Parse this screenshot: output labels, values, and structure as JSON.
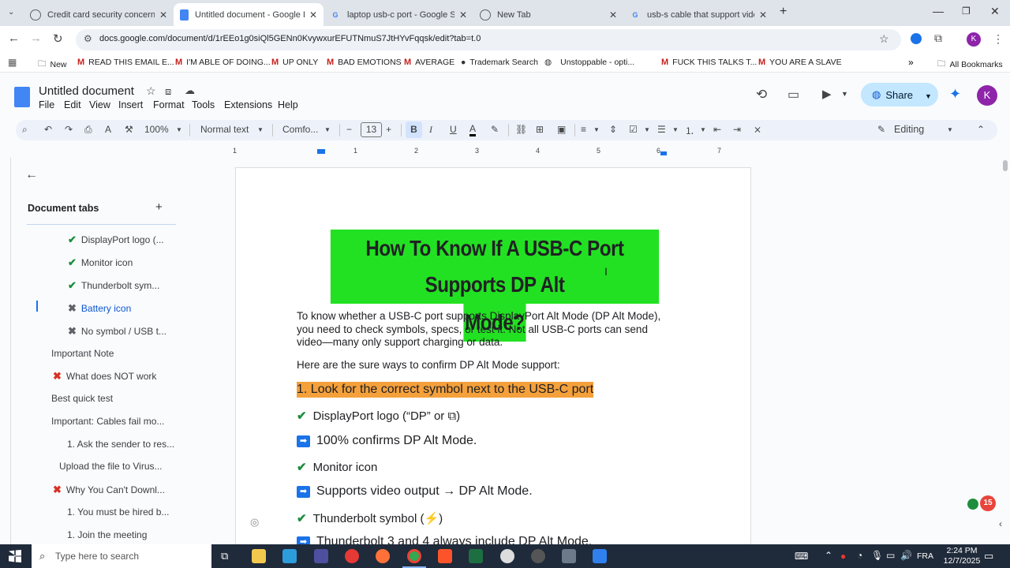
{
  "browser": {
    "tabs": [
      {
        "title": "Credit card security concerns",
        "favicon_color": "#5f6368"
      },
      {
        "title": "Untitled document - Google Do",
        "favicon_color": "#4285f4"
      },
      {
        "title": "laptop usb-c port - Google Sea",
        "favicon_color": "#34a853"
      },
      {
        "title": "New Tab",
        "favicon_color": "#5f6368"
      },
      {
        "title": "usb-s cable that support video",
        "favicon_color": "#34a853"
      }
    ],
    "url": "docs.google.com/document/d/1rEEo1g0siQl5GENn0KvywxurEFUTNmuS7JtHYvFqqsk/edit?tab=t.0",
    "bookmarks": [
      {
        "label": "New"
      },
      {
        "label": "READ THIS EMAIL E..."
      },
      {
        "label": "I'M ABLE OF DOING..."
      },
      {
        "label": "UP ONLY"
      },
      {
        "label": "BAD EMOTIONS"
      },
      {
        "label": "AVERAGE"
      },
      {
        "label": "Trademark Search"
      },
      {
        "label": "Unstoppable - opti..."
      },
      {
        "label": "FUCK THIS TALKS T..."
      },
      {
        "label": "YOU ARE A SLAVE"
      }
    ],
    "all_bookmarks": "All Bookmarks",
    "profile_initial": "K"
  },
  "docs": {
    "title": "Untitled document",
    "menus": [
      "File",
      "Edit",
      "View",
      "Insert",
      "Format",
      "Tools",
      "Extensions",
      "Help"
    ],
    "share_label": "Share",
    "toolbar": {
      "zoom": "100%",
      "style": "Normal text",
      "font": "Comfo...",
      "font_size": "13",
      "mode": "Editing"
    },
    "ruler_numbers": [
      "1",
      "1",
      "2",
      "3",
      "4",
      "5",
      "6",
      "7"
    ]
  },
  "sidebar": {
    "heading": "Document tabs",
    "items": [
      {
        "label": "DisplayPort logo (...",
        "mark": "check"
      },
      {
        "label": "Monitor icon",
        "mark": "check"
      },
      {
        "label": "Thunderbolt sym...",
        "mark": "check"
      },
      {
        "label": "Battery icon",
        "mark": "cross"
      },
      {
        "label": "No symbol / USB t...",
        "mark": "cross"
      },
      {
        "label": "Important Note",
        "mark": ""
      },
      {
        "label": "What does NOT work",
        "mark": "redcross"
      },
      {
        "label": "Best quick test",
        "mark": ""
      },
      {
        "label": "Important: Cables fail mo...",
        "mark": ""
      },
      {
        "label": "1. Ask the sender to res...",
        "mark": ""
      },
      {
        "label": "Upload the file to Virus...",
        "mark": ""
      },
      {
        "label": "Why You Can't Downl...",
        "mark": "redcross"
      },
      {
        "label": "1. You must be hired b...",
        "mark": ""
      },
      {
        "label": "1. Join the meeting",
        "mark": ""
      }
    ]
  },
  "document": {
    "title_line1": "How To Know If A USB-C Port Supports DP Alt",
    "title_line2": "Mode?",
    "intro": "To know whether a USB-C port supports DisplayPort Alt Mode (DP Alt Mode), you need to check symbols, specs, or test it. Not all USB-C ports can send video—many only support charging or data.",
    "subintro": "Here are the sure ways to confirm DP Alt Mode support:",
    "section1": "1. Look for the correct symbol next to the USB-C port",
    "item1": "DisplayPort logo (“DP” or ⧉)",
    "item1_note": "100% confirms DP Alt Mode.",
    "item2": "Monitor icon",
    "item2_note": "Supports video output → DP Alt Mode.",
    "item3": "Thunderbolt symbol (⚡)",
    "item3_note": "Thunderbolt 3 and 4 always include DP Alt Mode.",
    "badge_count": "15",
    "colors": {
      "title_highlight": "#22e122",
      "section_highlight": "#f4a03b",
      "check": "#1e8e3e"
    }
  },
  "taskbar": {
    "search_placeholder": "Type here to search",
    "lang": "FRA",
    "time": "2:24 PM",
    "date": "12/7/2025"
  }
}
